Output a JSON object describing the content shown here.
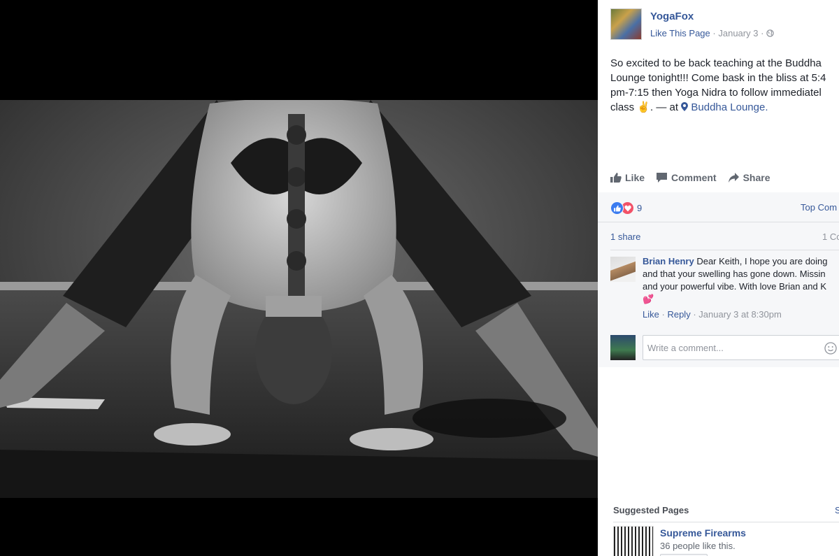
{
  "page": {
    "name": "YogaFox",
    "like_page": "Like This Page",
    "date": "January 3",
    "sep": "·"
  },
  "post": {
    "line1": "So excited to be back teaching at the Buddha",
    "line2": "Lounge tonight!!! Come bask in the bliss at 5:4",
    "line3": "pm-7:15 then Yoga Nidra to follow immediatel",
    "line4_pre": "class ✌️. — at",
    "location": "Buddha Lounge."
  },
  "actions": {
    "like": "Like",
    "comment": "Comment",
    "share": "Share"
  },
  "feedback": {
    "reaction_count": "9",
    "top_comments": "Top Com",
    "shares": "1 share",
    "comments_count": "1 Co"
  },
  "comment": {
    "author": "Brian Henry",
    "line1": "Dear Keith, I hope you are doing",
    "line2": "and that your swelling has gone down. Missin",
    "line3": "and your powerful vibe. With love Brian and K",
    "emoji": "💕",
    "like": "Like",
    "reply": "Reply",
    "date": "January 3 at 8:30pm",
    "sep": "·"
  },
  "compose": {
    "placeholder": "Write a comment..."
  },
  "suggested": {
    "title": "Suggested Pages",
    "see_all": "S",
    "item_name": "Supreme Firearms",
    "item_likes": "36 people like this."
  },
  "colors": {
    "link": "#365899",
    "meta": "#90949c",
    "like_reaction": "#3b7cf0",
    "love_reaction": "#f25268"
  }
}
